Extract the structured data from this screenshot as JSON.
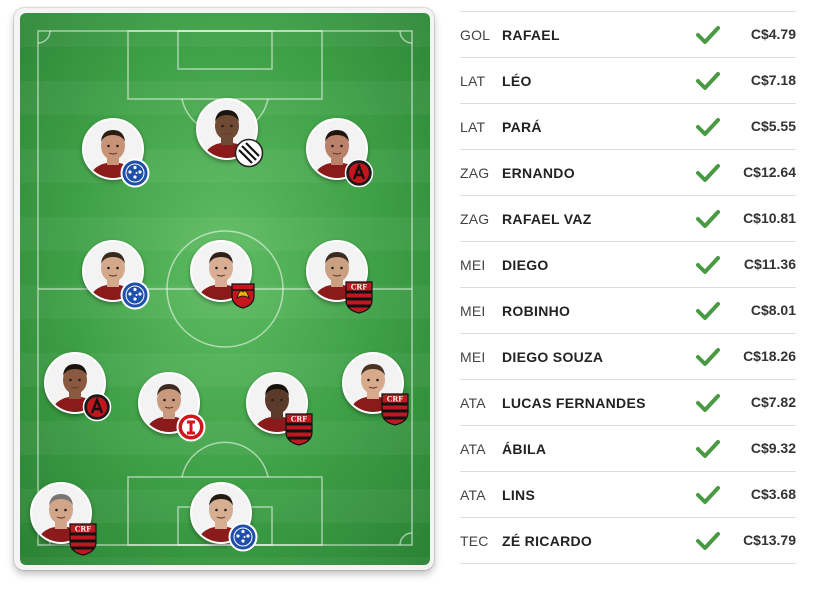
{
  "colors": {
    "accent_check": "#4a9a44",
    "pitch_green": "#3d9f45"
  },
  "lineup": [
    {
      "pos": "GOL",
      "name": "RAFAEL",
      "price": "C$4.79",
      "status_icon": "check-icon"
    },
    {
      "pos": "LAT",
      "name": "LÉO",
      "price": "C$7.18",
      "status_icon": "check-icon"
    },
    {
      "pos": "LAT",
      "name": "PARÁ",
      "price": "C$5.55",
      "status_icon": "check-icon"
    },
    {
      "pos": "ZAG",
      "name": "ERNANDO",
      "price": "C$12.64",
      "status_icon": "check-icon"
    },
    {
      "pos": "ZAG",
      "name": "RAFAEL VAZ",
      "price": "C$10.81",
      "status_icon": "check-icon"
    },
    {
      "pos": "MEI",
      "name": "DIEGO",
      "price": "C$11.36",
      "status_icon": "check-icon"
    },
    {
      "pos": "MEI",
      "name": "ROBINHO",
      "price": "C$8.01",
      "status_icon": "check-icon"
    },
    {
      "pos": "MEI",
      "name": "DIEGO SOUZA",
      "price": "C$18.26",
      "status_icon": "check-icon"
    },
    {
      "pos": "ATA",
      "name": "LUCAS FERNANDES",
      "price": "C$7.82",
      "status_icon": "check-icon"
    },
    {
      "pos": "ATA",
      "name": "ÁBILA",
      "price": "C$9.32",
      "status_icon": "check-icon"
    },
    {
      "pos": "ATA",
      "name": "LINS",
      "price": "C$3.68",
      "status_icon": "check-icon"
    },
    {
      "pos": "TEC",
      "name": "ZÉ RICARDO",
      "price": "C$13.79",
      "status_icon": "check-icon"
    }
  ],
  "pitch_players": [
    {
      "id": "p1",
      "skin": "#c89478",
      "hair": "#2a1d15",
      "badge": "cruzeiro-crest-icon"
    },
    {
      "id": "p2",
      "skin": "#6e4a35",
      "hair": "#1a1410",
      "badge": "figueirense-crest-icon"
    },
    {
      "id": "p3",
      "skin": "#b9806a",
      "hair": "#1e1510",
      "badge": "atletico-pr-crest-icon"
    },
    {
      "id": "p4",
      "skin": "#d4a88a",
      "hair": "#3a2a1e",
      "badge": "cruzeiro-crest-icon"
    },
    {
      "id": "p5",
      "skin": "#d9ae94",
      "hair": "#2e2018",
      "badge": "sport-crest-icon"
    },
    {
      "id": "p6",
      "skin": "#caa083",
      "hair": "#3b2a20",
      "badge": "flamengo-crest-icon"
    },
    {
      "id": "p7",
      "skin": "#8a5a40",
      "hair": "#1a120c",
      "badge": "atletico-pr-crest-icon"
    },
    {
      "id": "p8",
      "skin": "#c99a7e",
      "hair": "#3a2c22",
      "badge": "internacional-crest-icon"
    },
    {
      "id": "p9",
      "skin": "#5a3a28",
      "hair": "#15100c",
      "badge": "flamengo-crest-icon"
    },
    {
      "id": "p10",
      "skin": "#d8aa8c",
      "hair": "#4a3424",
      "badge": "flamengo-crest-icon"
    },
    {
      "id": "p11",
      "skin": "#d1a58a",
      "hair": "#7a7570",
      "badge": "flamengo-crest-icon"
    },
    {
      "id": "p12",
      "skin": "#d6ae92",
      "hair": "#231a14",
      "badge": "cruzeiro-crest-icon"
    }
  ]
}
